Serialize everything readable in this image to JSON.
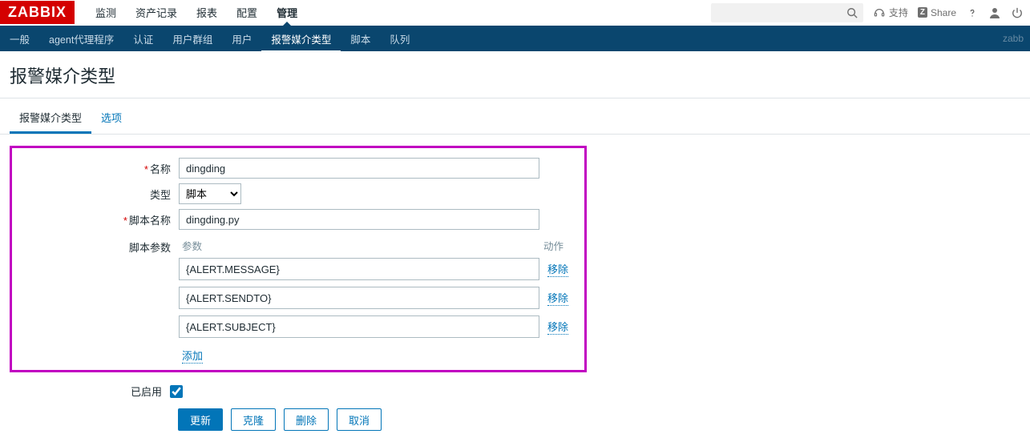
{
  "logo": "ZABBIX",
  "main_nav": {
    "items": [
      "监测",
      "资产记录",
      "报表",
      "配置",
      "管理"
    ],
    "active_index": 4
  },
  "top_right": {
    "support": "支持",
    "share": "Share",
    "share_badge": "Z"
  },
  "sub_nav": {
    "items": [
      "一般",
      "agent代理程序",
      "认证",
      "用户群组",
      "用户",
      "报警媒介类型",
      "脚本",
      "队列"
    ],
    "active_index": 5,
    "brand_right": "zabb"
  },
  "page_title": "报警媒介类型",
  "tabs": {
    "items": [
      "报警媒介类型",
      "选项"
    ],
    "active_index": 0
  },
  "form": {
    "name_label": "名称",
    "name_value": "dingding",
    "type_label": "类型",
    "type_value": "脚本",
    "script_name_label": "脚本名称",
    "script_name_value": "dingding.py",
    "params_label": "脚本参数",
    "params_header_param": "参数",
    "params_header_action": "动作",
    "params": [
      {
        "value": "{ALERT.MESSAGE}"
      },
      {
        "value": "{ALERT.SENDTO}"
      },
      {
        "value": "{ALERT.SUBJECT}"
      }
    ],
    "remove_label": "移除",
    "add_label": "添加",
    "enabled_label": "已启用",
    "enabled_checked": true
  },
  "buttons": {
    "update": "更新",
    "clone": "克隆",
    "delete": "删除",
    "cancel": "取消"
  }
}
